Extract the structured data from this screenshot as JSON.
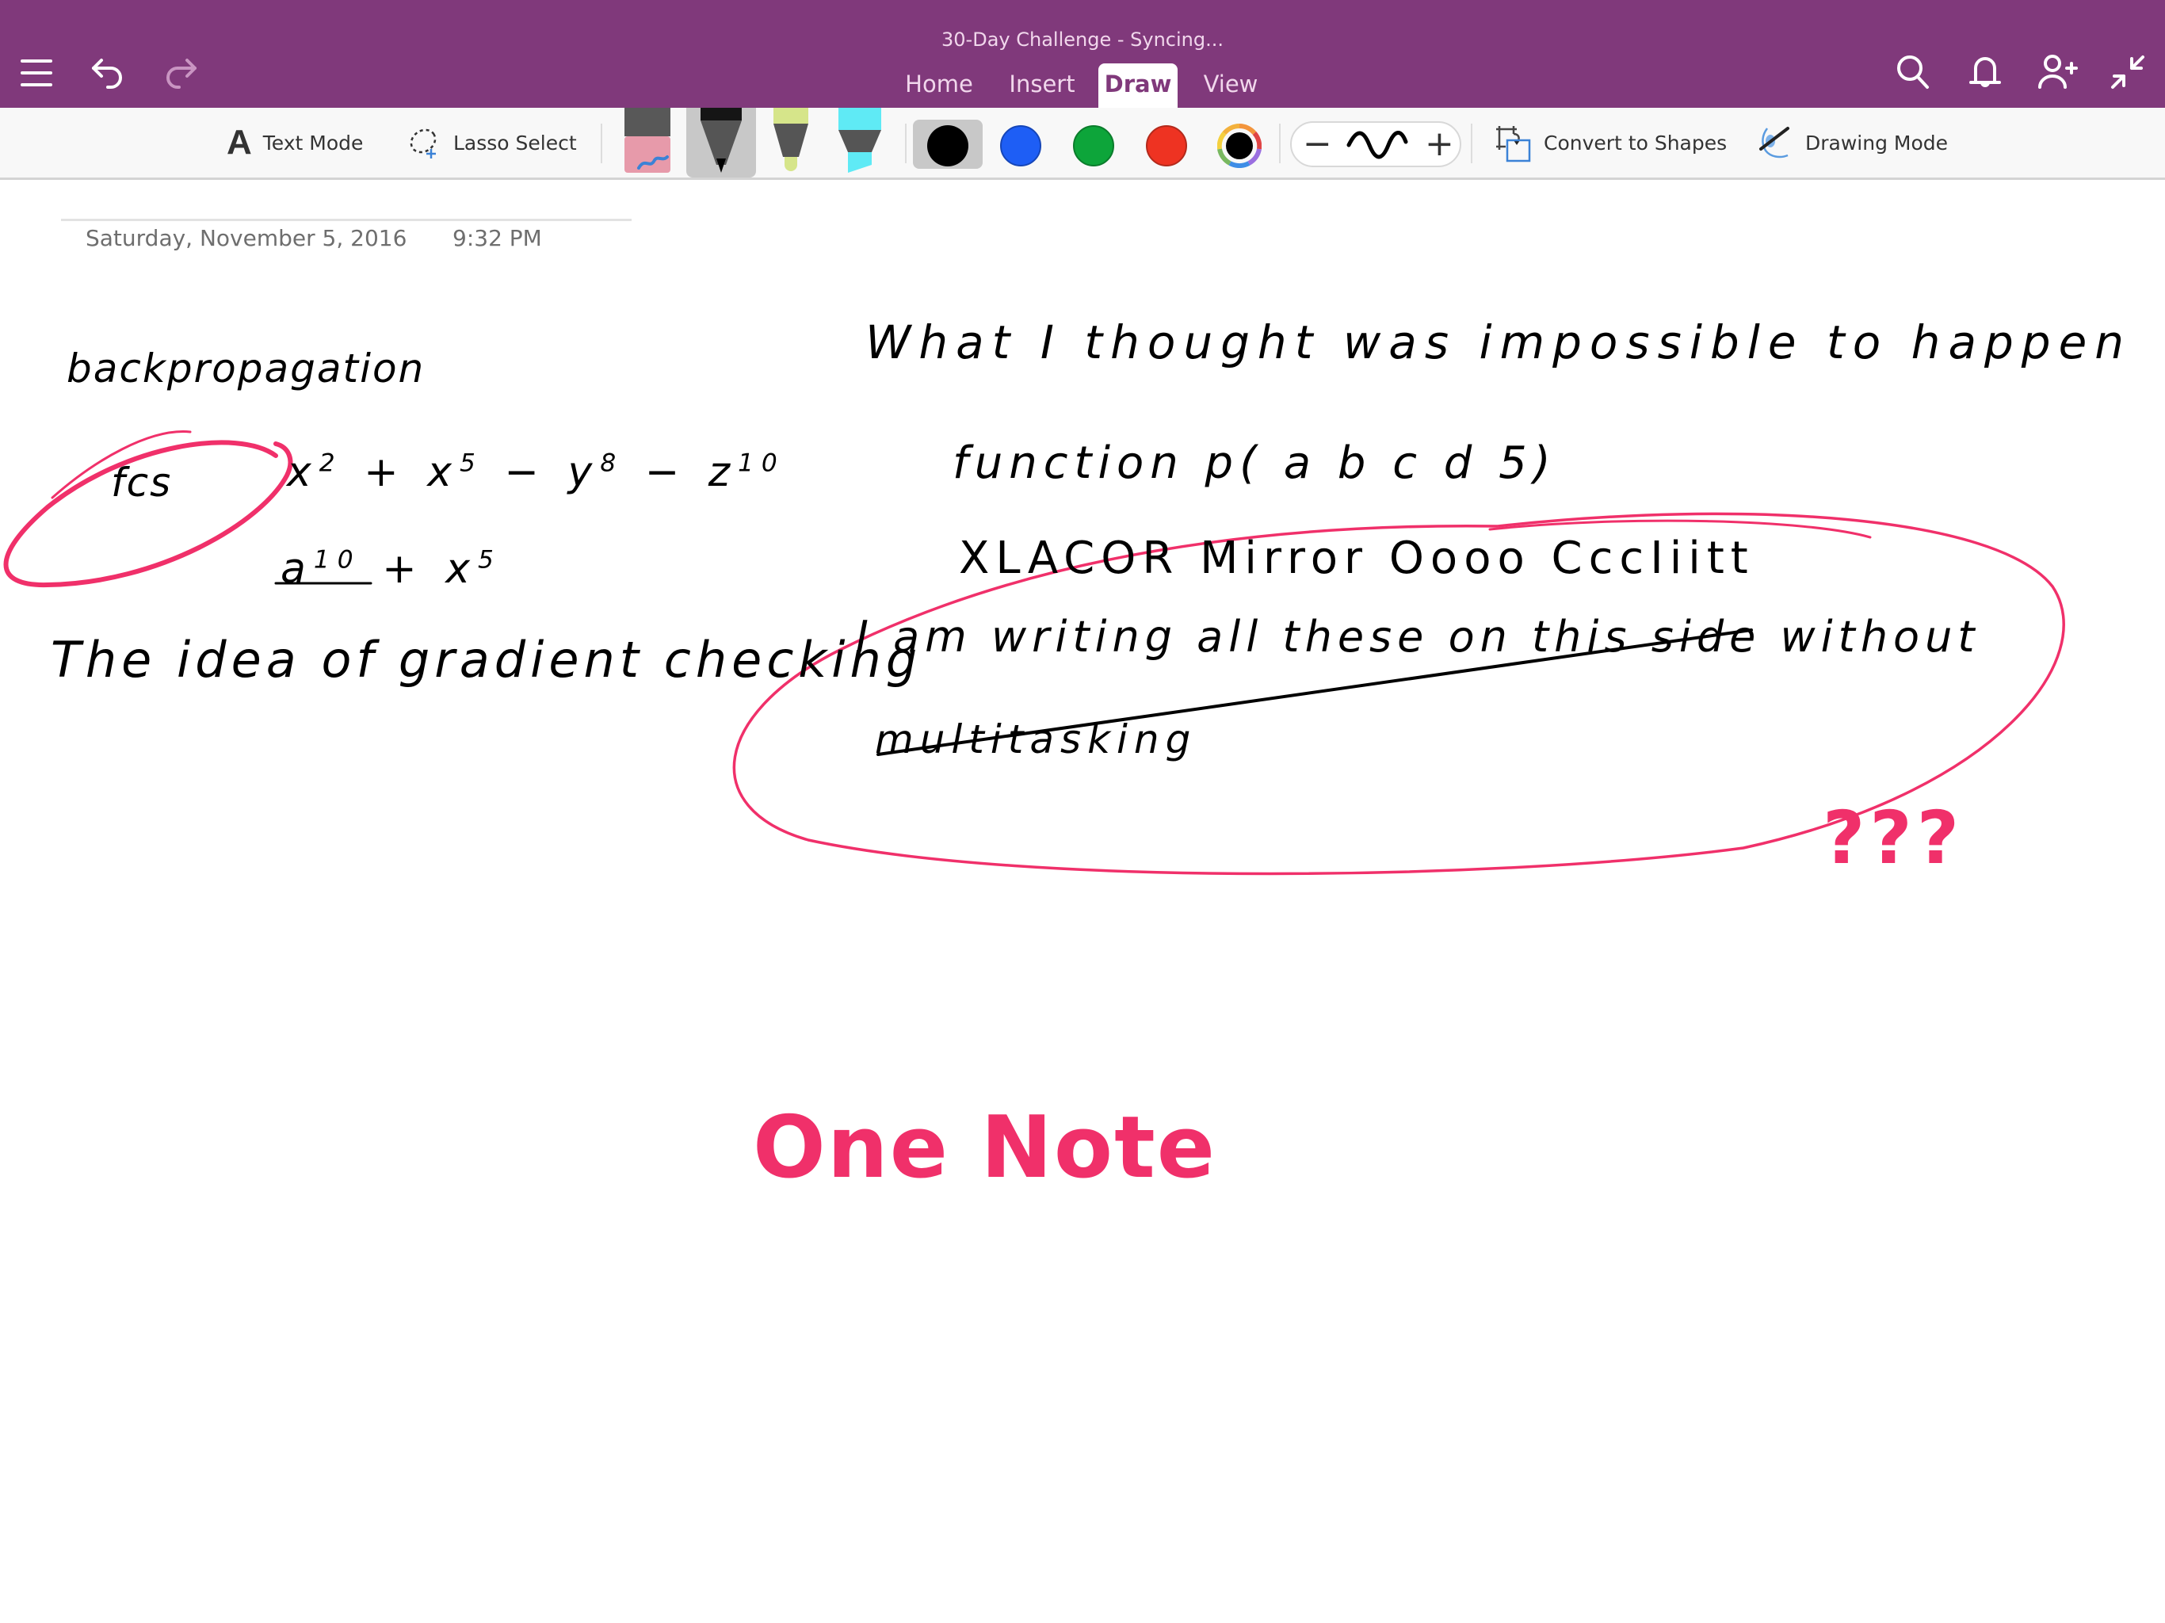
{
  "header": {
    "title": "30-Day Challenge - Syncing...",
    "tabs": [
      {
        "label": "Home",
        "active": false
      },
      {
        "label": "Insert",
        "active": false
      },
      {
        "label": "Draw",
        "active": true
      },
      {
        "label": "View",
        "active": false
      }
    ],
    "left_icons": [
      "menu-icon",
      "undo-icon",
      "redo-icon"
    ],
    "right_icons": [
      "search-icon",
      "bell-icon",
      "add-person-icon",
      "collapse-icon"
    ],
    "accent": "#80397B"
  },
  "toolbar": {
    "text_mode": "Text Mode",
    "lasso_select": "Lasso Select",
    "pens": [
      {
        "name": "eraser",
        "selected": false
      },
      {
        "name": "pen",
        "selected": true
      },
      {
        "name": "pencil",
        "selected": false
      },
      {
        "name": "highlighter",
        "selected": false
      }
    ],
    "colors": [
      {
        "name": "black",
        "hex": "#000000",
        "selected": true
      },
      {
        "name": "blue",
        "hex": "#1E5EF5",
        "selected": false
      },
      {
        "name": "green",
        "hex": "#0DA53A",
        "selected": false
      },
      {
        "name": "red",
        "hex": "#EE3322",
        "selected": false
      },
      {
        "name": "more-colors",
        "hex": "#000000",
        "selected": false
      }
    ],
    "thickness_minus": "−",
    "thickness_plus": "+",
    "convert_to_shapes": "Convert to Shapes",
    "drawing_mode": "Drawing Mode"
  },
  "page": {
    "date": "Saturday, November  5, 2016",
    "time": "9:32 PM",
    "ink": {
      "backprop": "backpropagation",
      "fc": "fcs",
      "eq1": {
        "x1": "x",
        "e1": "2",
        "op1": "+",
        "x2": "x",
        "e2": "5",
        "op2": "−",
        "y": "y",
        "e3": "8",
        "op3": "−",
        "z": "z",
        "e4": "10"
      },
      "eq2": {
        "a": "a",
        "e1": "10",
        "op": "+",
        "x": "x",
        "e2": "5"
      },
      "gradient": "The idea of gradient checking",
      "thought": "What I thought was impossible to happen",
      "function": "function   p( a  b  c  d  5)",
      "xlacor": "XLACOR Mirror   Oooo CccIiitt",
      "writing": "I am writing all these on this side without",
      "multitasking": "multitasking",
      "question": "???",
      "onenote": "One Note"
    },
    "ink_pink": "#F0306A"
  }
}
